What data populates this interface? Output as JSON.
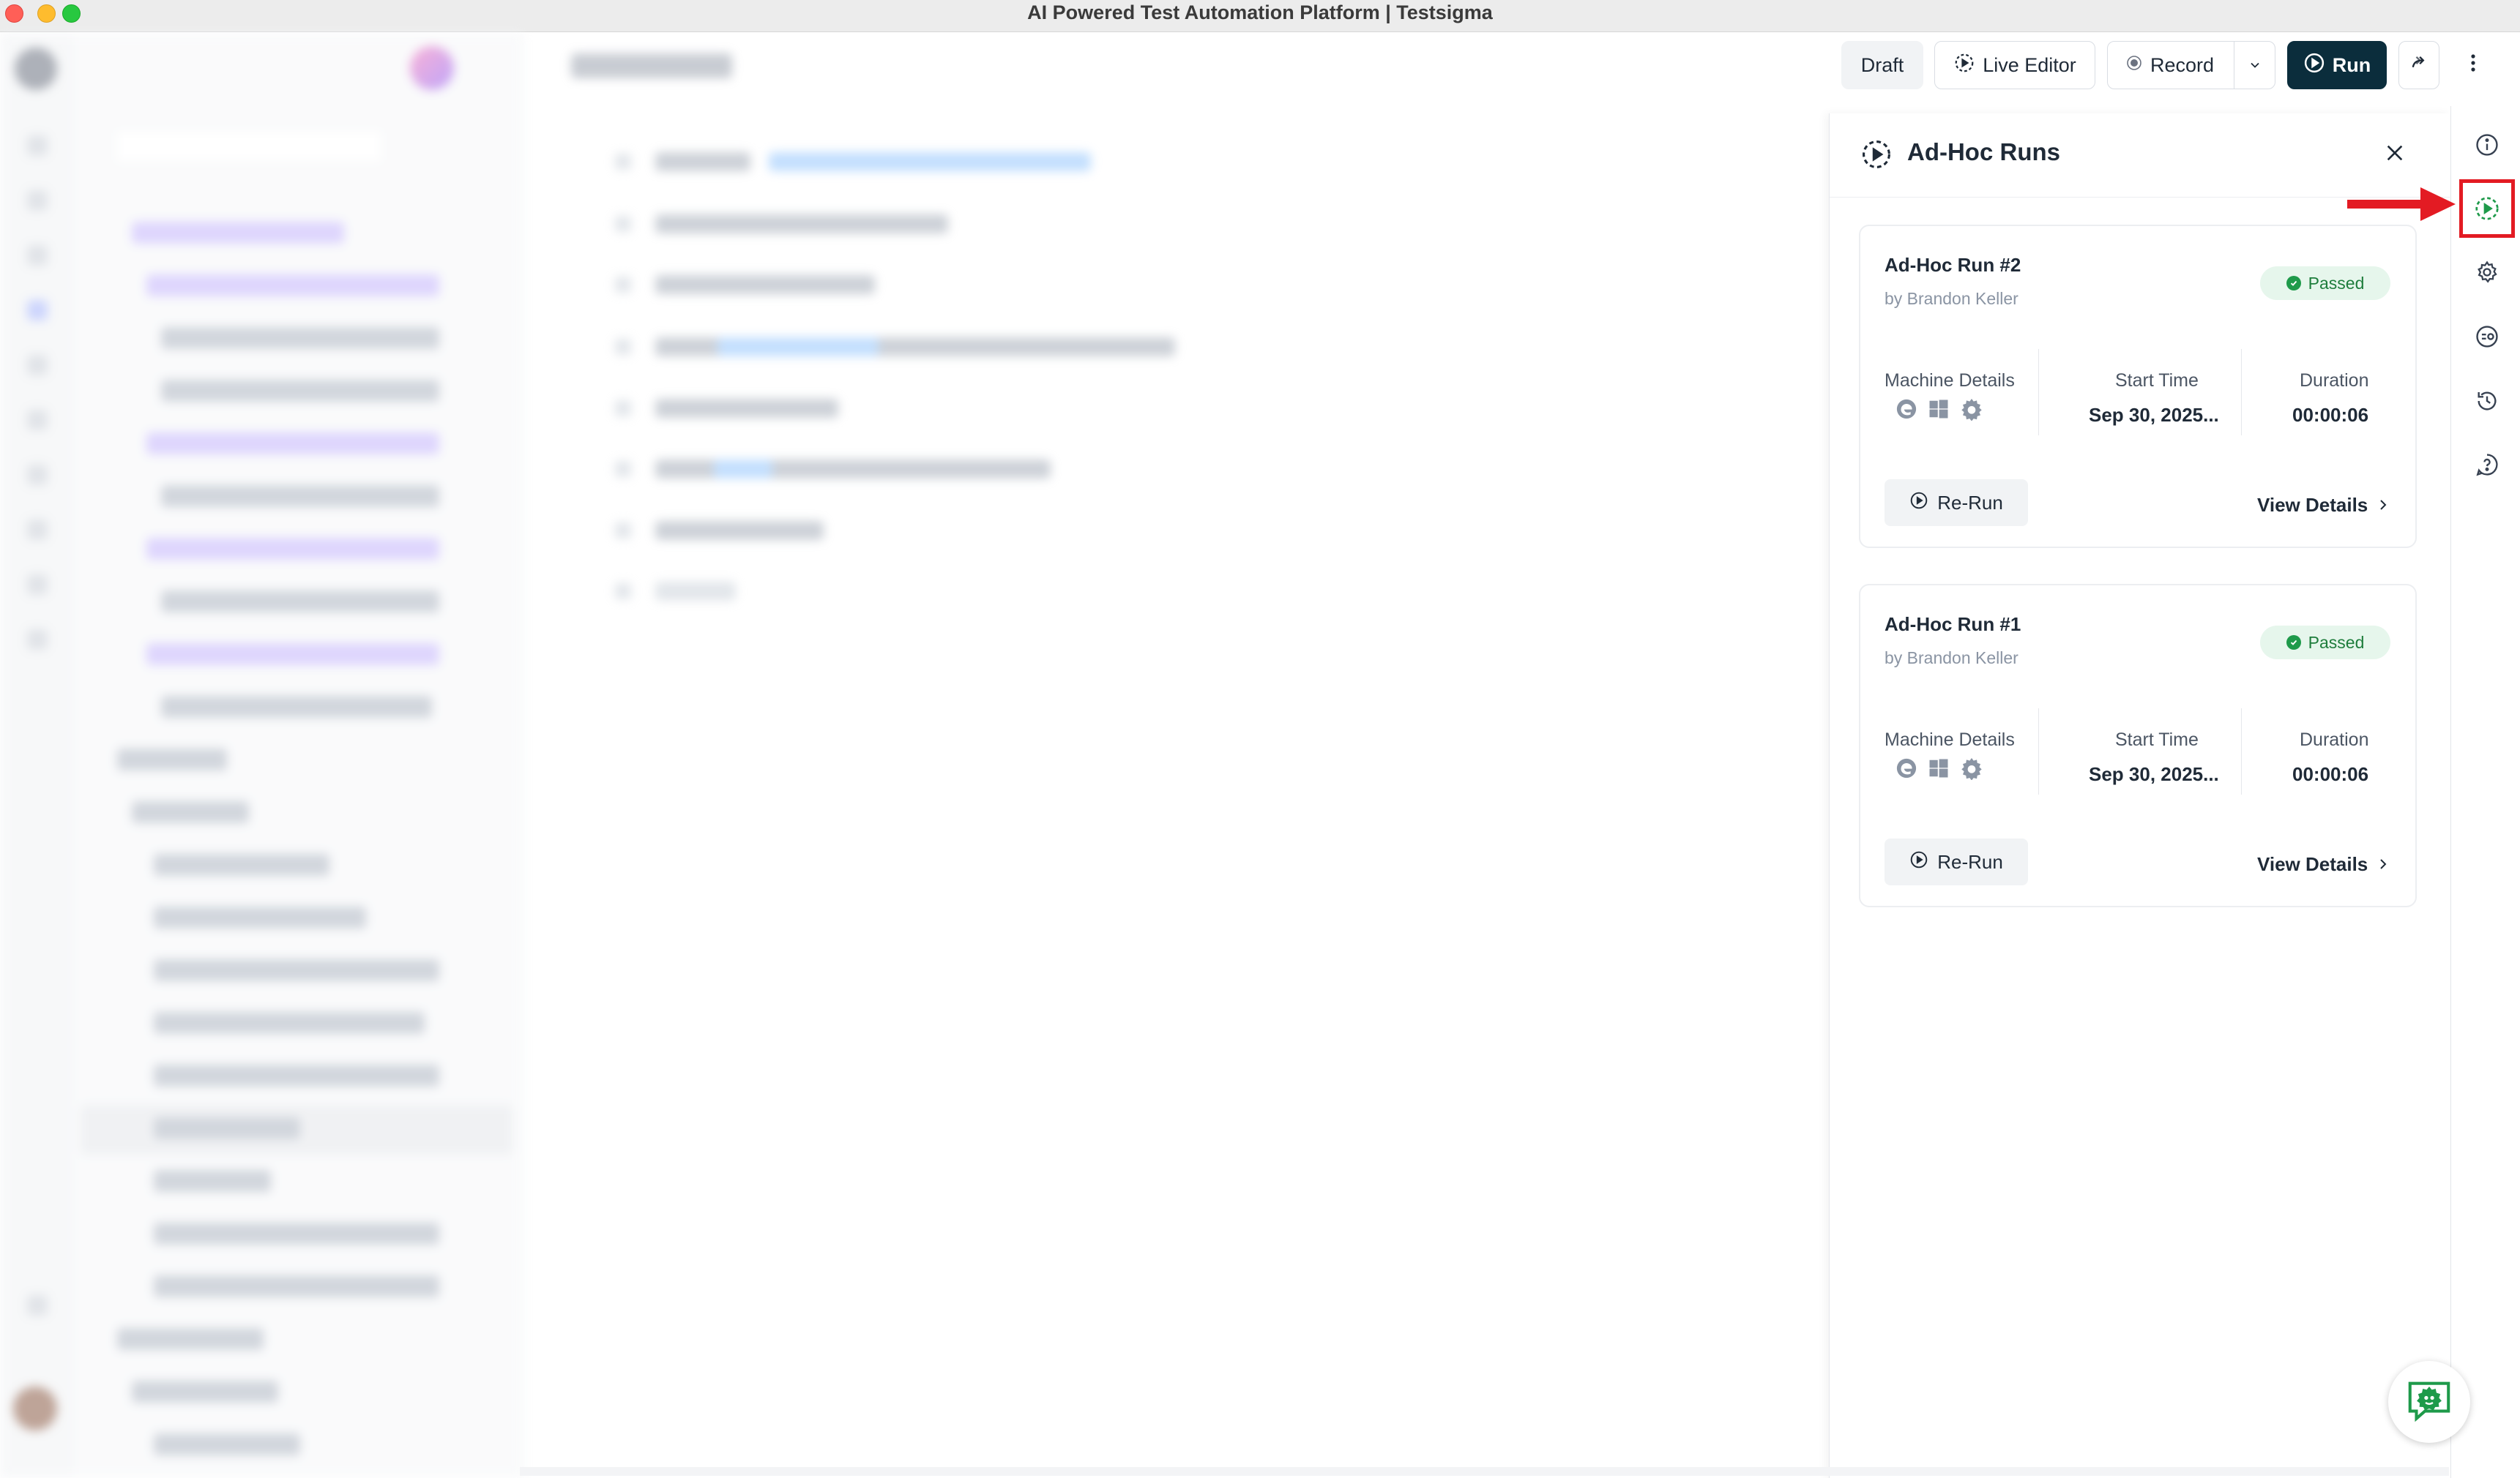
{
  "window": {
    "title": "AI Powered Test Automation Platform | Testsigma"
  },
  "toolbar": {
    "draft_label": "Draft",
    "live_editor_label": "Live Editor",
    "record_label": "Record",
    "run_label": "Run"
  },
  "panel": {
    "title": "Ad-Hoc Runs",
    "runs": [
      {
        "title": "Ad-Hoc Run #2",
        "by": "by Brandon Keller",
        "status": "Passed",
        "machine_label": "Machine Details",
        "start_label": "Start Time",
        "start_value": "Sep 30, 2025...",
        "duration_label": "Duration",
        "duration_value": "00:00:06",
        "rerun_label": "Re-Run",
        "view_details_label": "View Details"
      },
      {
        "title": "Ad-Hoc Run #1",
        "by": "by Brandon Keller",
        "status": "Passed",
        "machine_label": "Machine Details",
        "start_label": "Start Time",
        "start_value": "Sep 30, 2025...",
        "duration_label": "Duration",
        "duration_value": "00:00:06",
        "rerun_label": "Re-Run",
        "view_details_label": "View Details"
      }
    ]
  },
  "icons": {
    "machine": [
      "edge-browser-icon",
      "windows-os-icon",
      "settings-gear-icon"
    ],
    "utility_rail": [
      "info-icon",
      "adhoc-runs-icon",
      "settings-icon",
      "environment-icon",
      "history-icon",
      "help-icon"
    ]
  },
  "colors": {
    "run_button_bg": "#0b2d3c",
    "passed_badge_bg": "#e6f6ec",
    "passed_text": "#1e7d3c",
    "highlight": "#e31b23",
    "accent_green": "#1e9a4a"
  }
}
